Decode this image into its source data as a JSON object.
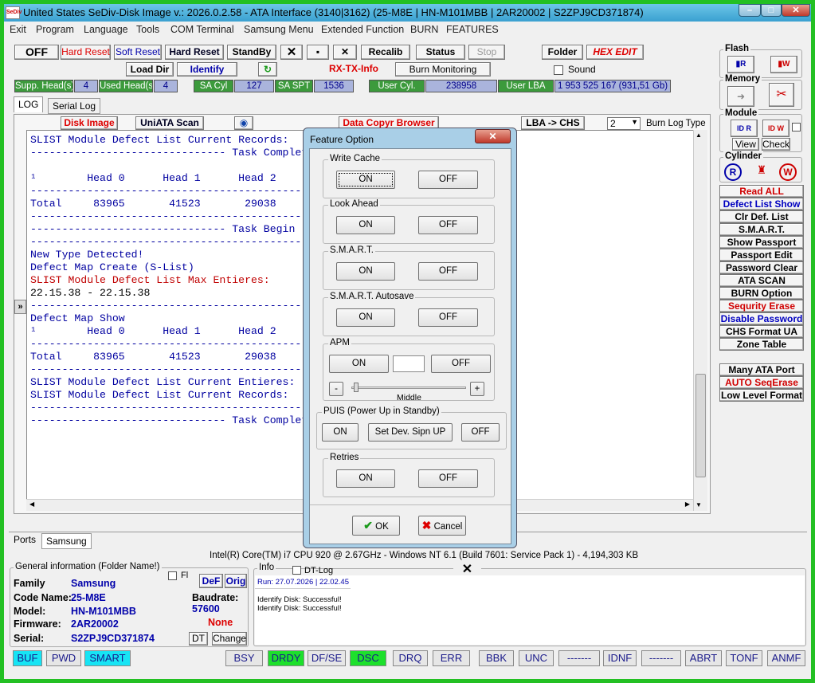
{
  "title": {
    "icon": "SeDiv",
    "text": "United States  SeDiv-Disk Image v.: 2026.0.2.58 - ATA Interface (3140|3162)  (25-M8E | HN-M101MBB | 2AR20002 | S2ZPJ9CD371874)"
  },
  "menu": [
    "Exit",
    "Program",
    "Language",
    "Tools",
    "COM Terminal",
    "Samsung Menu",
    "Extended Function",
    "BURN",
    "FEATURES"
  ],
  "toolbar": {
    "off": "OFF",
    "hard_reset_red": "Hard Reset",
    "soft_reset": "Soft Reset",
    "hard_reset": "Hard Reset",
    "standby": "StandBy",
    "recalib": "Recalib",
    "status": "Status",
    "stop": "Stop",
    "folder": "Folder",
    "hex_edit": "HEX EDIT",
    "load_dir": "Load Dir",
    "identify": "Identify",
    "rx_tx": "RX-TX-Info",
    "burn_monitoring": "Burn Monitoring",
    "sound": "Sound"
  },
  "info_row": {
    "supp_heads_label": "Supp. Head(s)",
    "supp_heads": "4",
    "used_heads_label": "Used Head(s)",
    "used_heads": "4",
    "sa_cyl_label": "SA Cyl",
    "sa_cyl": "127",
    "sa_spt_label": "SA SPT",
    "sa_spt": "1536",
    "user_cyl_label": "User Cyl.",
    "user_cyl": "238958",
    "user_lba_label": "User LBA",
    "user_lba": "1 953 525 167  (931,51 Gb)"
  },
  "tabs": {
    "log": "LOG",
    "serial_log": "Serial Log"
  },
  "log_toolbar": {
    "disk_image": "Disk Image",
    "uniata_scan": "UniATA Scan",
    "data_copy": "Data Copyr Browser",
    "lba_chs": "LBA -> CHS",
    "burn_value": "2",
    "burn_log_type": "Burn Log Type"
  },
  "log_lines": [
    {
      "text": "SLIST Module Defect List Current Records:",
      "color": "#0000a0"
    },
    {
      "text": "------------------------------- Task Complete",
      "color": "#0000a0"
    },
    {
      "text": "",
      "color": "#0000a0"
    },
    {
      "text": "¹        Head 0      Head 1      Head 2",
      "color": "#0000a0"
    },
    {
      "text": "--------------------------------------------------------",
      "color": "#0000a0"
    },
    {
      "text": "Total     83965       41523       29038",
      "color": "#0000a0"
    },
    {
      "text": "--------------------------------------------------------",
      "color": "#0000a0"
    },
    {
      "text": "------------------------------- Task Begin",
      "color": "#0000a0"
    },
    {
      "text": "--------------------------------------------------------",
      "color": "#0000a0"
    },
    {
      "text": "New Type Detected!",
      "color": "#0000a0"
    },
    {
      "text": "Defect Map Create (S-List)",
      "color": "#0000a0"
    },
    {
      "text": "SLIST Module Defect List Max Entieres:",
      "color": "#c00000"
    },
    {
      "text": "22.15.38 - 22.15.38",
      "color": "#000000"
    },
    {
      "text": "--------------------------------------------------------",
      "color": "#0000a0"
    },
    {
      "text": "Defect Map Show",
      "color": "#0000a0"
    },
    {
      "text": "¹        Head 0      Head 1      Head 2",
      "color": "#0000a0"
    },
    {
      "text": "--------------------------------------------------------",
      "color": "#0000a0"
    },
    {
      "text": "Total     83965       41523       29038",
      "color": "#0000a0"
    },
    {
      "text": "--------------------------------------------------------",
      "color": "#0000a0"
    },
    {
      "text": "SLIST Module Defect List Current Entieres:",
      "color": "#0000a0"
    },
    {
      "text": "SLIST Module Defect List Current Records:",
      "color": "#0000a0"
    },
    {
      "text": "--------------------------------------------------------",
      "color": "#0000a0"
    },
    {
      "text": "------------------------------- Task Complete",
      "color": "#0000a0"
    }
  ],
  "right_panel": {
    "flash": "Flash",
    "memory": "Memory",
    "module": "Module",
    "view": "View",
    "check": "Check",
    "cylinder": "Cylinder",
    "items": [
      {
        "label": "Read ALL",
        "color": "#d00000"
      },
      {
        "label": "Defect List Show",
        "color": "#0000c0"
      },
      {
        "label": "Clr Def. List",
        "color": "#000"
      },
      {
        "label": "S.M.A.R.T.",
        "color": "#000"
      },
      {
        "label": "Show Passport",
        "color": "#000"
      },
      {
        "label": "Passport Edit",
        "color": "#000"
      },
      {
        "label": "Password Clear",
        "color": "#000"
      },
      {
        "label": "ATA SCAN",
        "color": "#000"
      },
      {
        "label": "BURN Option",
        "color": "#000"
      },
      {
        "label": "Sequrity Erase",
        "color": "#d00000"
      },
      {
        "label": "Disable Password",
        "color": "#0000c0"
      },
      {
        "label": "CHS Format UA",
        "color": "#000"
      },
      {
        "label": "Zone Table",
        "color": "#000"
      }
    ],
    "items2": [
      {
        "label": "Many ATA Port",
        "color": "#000"
      },
      {
        "label": "AUTO SeqErase",
        "color": "#d00000"
      },
      {
        "label": "Low Level Format",
        "color": "#000"
      }
    ]
  },
  "bottom_tabs": {
    "ports": "Ports",
    "samsung": "Samsung"
  },
  "cpu_info": "Intel(R) Core(TM) i7 CPU 920  @ 2.67GHz - Windows NT 6.1 (Build 7601: Service Pack 1) -  4,194,303 KB",
  "general": {
    "title": "General information (Folder Name!)",
    "fl": "Fl",
    "def": "DeF",
    "orig": "Orig",
    "family_label": "Family",
    "family": "Samsung",
    "code_label": "Code Name:",
    "code": "25-M8E",
    "model_label": "Model:",
    "model": "HN-M101MBB",
    "firmware_label": "Firmware:",
    "firmware": "2AR20002",
    "serial_label": "Serial:",
    "serial": "S2ZPJ9CD371874",
    "baud_label": "Baudrate:",
    "baud": "57600",
    "none": "None",
    "dt": "DT",
    "change": "Change"
  },
  "info_panel": {
    "title": "Info",
    "dt_log": "DT-Log",
    "lines": [
      "Run: 27.07.2026 | 22.02.45",
      "",
      "Identify Disk: Successful!",
      "Identify Disk: Successful!"
    ]
  },
  "status_bar": [
    {
      "label": "BUF",
      "state": "cyan"
    },
    {
      "label": "PWD",
      "state": "off"
    },
    {
      "label": "SMART",
      "state": "cyan"
    },
    {
      "label": "BSY",
      "state": "off"
    },
    {
      "label": "DRDY",
      "state": "lime"
    },
    {
      "label": "DF/SE",
      "state": "off"
    },
    {
      "label": "DSC",
      "state": "lime"
    },
    {
      "label": "DRQ",
      "state": "off"
    },
    {
      "label": "ERR",
      "state": "off"
    },
    {
      "label": "BBK",
      "state": "off"
    },
    {
      "label": "UNC",
      "state": "off"
    },
    {
      "label": "-------",
      "state": "off"
    },
    {
      "label": "IDNF",
      "state": "off"
    },
    {
      "label": "-------",
      "state": "off"
    },
    {
      "label": "ABRT",
      "state": "off"
    },
    {
      "label": "TONF",
      "state": "off"
    },
    {
      "label": "ANMF",
      "state": "off"
    }
  ],
  "dialog": {
    "title": "Feature Option",
    "write_cache": "Write Cache",
    "look_ahead": "Look Ahead",
    "smart": "S.M.A.R.T.",
    "smart_autosave": "S.M.A.R.T. Autosave",
    "apm": "APM",
    "apm_value": "",
    "middle": "Middle",
    "puis": "PUIS (Power Up in Standby)",
    "set_dev": "Set Dev. Sipn UP",
    "retries": "Retries",
    "on": "ON",
    "off": "OFF",
    "ok": "OK",
    "cancel": "Cancel",
    "minus": "-",
    "plus": "+"
  }
}
